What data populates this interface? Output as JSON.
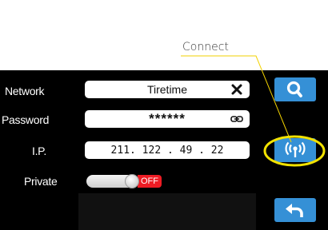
{
  "annotation": {
    "label": "Connect",
    "line_color": "#f2d200",
    "highlight_color": "#f2e200"
  },
  "form": {
    "network": {
      "label": "Network",
      "value": "Tiretime",
      "clear_icon": "close-icon"
    },
    "password": {
      "label": "Password",
      "value": "******",
      "icon": "link-icon"
    },
    "ip": {
      "label": "I.P.",
      "value": "211. 122 . 49 . 22"
    },
    "private": {
      "label": "Private",
      "state": "OFF",
      "enabled": false
    }
  },
  "buttons": {
    "search": {
      "icon": "search-icon"
    },
    "connect": {
      "icon": "wireless-signal-icon"
    },
    "back": {
      "icon": "back-arrow-icon"
    }
  },
  "colors": {
    "screen_bg": "#000000",
    "button_blue": "#3590d6",
    "toggle_off_red": "#ee1c24"
  }
}
